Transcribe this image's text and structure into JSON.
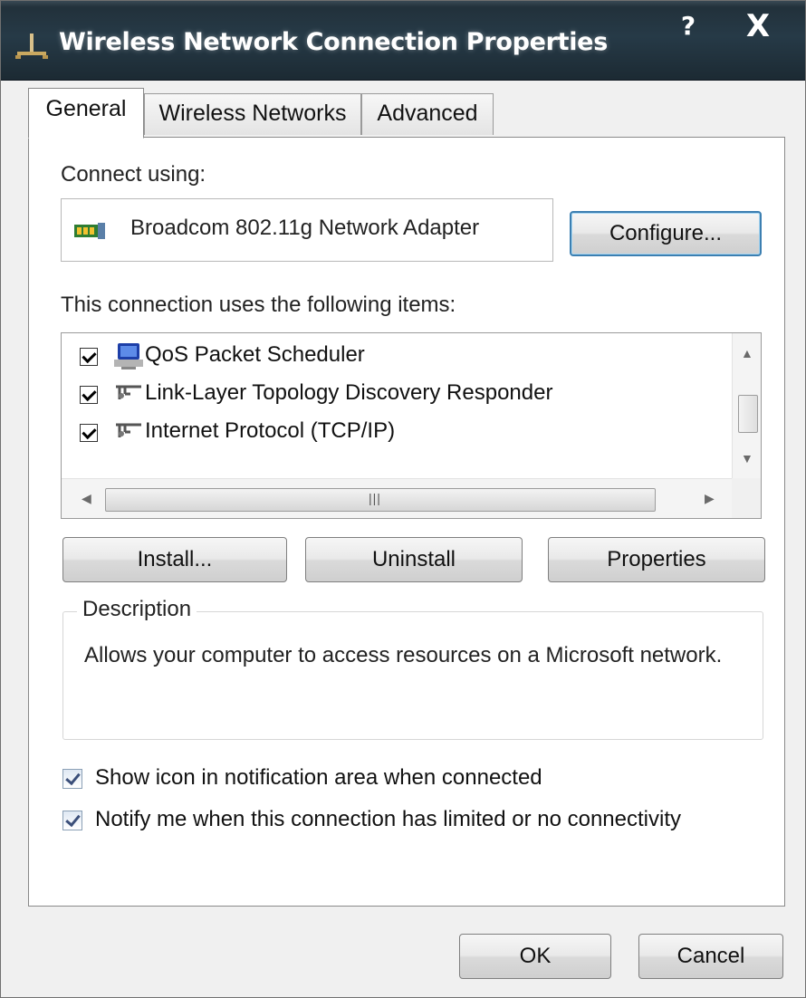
{
  "window": {
    "title": "Wireless Network Connection Properties",
    "help_label": "?",
    "close_label": "X"
  },
  "tabs": [
    {
      "label": "General",
      "active": true
    },
    {
      "label": "Wireless Networks",
      "active": false
    },
    {
      "label": "Advanced",
      "active": false
    }
  ],
  "general": {
    "connect_using_label": "Connect using:",
    "adapter_name": "Broadcom 802.11g Network Adapter",
    "configure_label": "Configure...",
    "items_label": "This connection uses the following items:",
    "items": [
      {
        "label": "QoS Packet Scheduler",
        "checked": true,
        "icon": "qos-scheduler-icon"
      },
      {
        "label": "Link-Layer Topology Discovery Responder",
        "checked": true,
        "icon": "network-protocol-icon"
      },
      {
        "label": "Internet Protocol (TCP/IP)",
        "checked": true,
        "icon": "network-protocol-icon"
      }
    ],
    "install_label": "Install...",
    "uninstall_label": "Uninstall",
    "properties_label": "Properties",
    "description_legend": "Description",
    "description_text": "Allows your computer to access resources on a Microsoft network.",
    "options": [
      {
        "label": "Show icon in notification area when connected",
        "checked": true
      },
      {
        "label": "Notify me when this connection has limited or no connectivity",
        "checked": true
      }
    ]
  },
  "footer": {
    "ok_label": "OK",
    "cancel_label": "Cancel"
  },
  "colors": {
    "title_bar": "#22313b",
    "focus_border": "#3c7fb1"
  }
}
